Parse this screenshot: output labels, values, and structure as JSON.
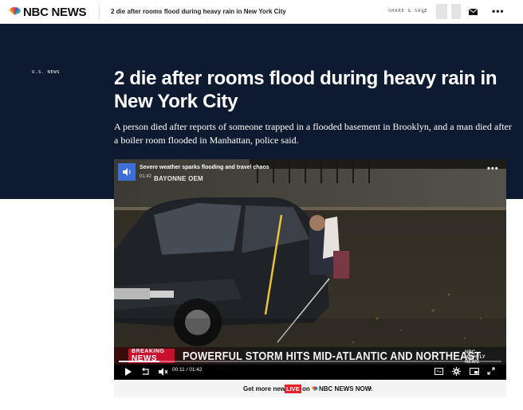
{
  "topbar": {
    "brand": "NBC NEWS",
    "article_title": "2 die after rooms flood during heavy rain in New York City",
    "share_label": "SHARE & SAVE",
    "menu_label": "•••"
  },
  "article": {
    "section": "U.S. NEWS",
    "headline": "2 die after rooms flood during heavy rain in New York City",
    "dek": "A person died after reports of someone trapped in a flooded basement in Brooklyn, and a man died after a boiler room flooded in Manhattan, police said."
  },
  "video": {
    "overlay_title": "Severe weather sparks flooding and travel chaos",
    "duration_badge": "01:42",
    "location_caption": "BAYONNE OEM",
    "breaking_top": "BREAKING",
    "breaking_bottom": "NEWS",
    "lower_third": "POWERFUL STORM HITS MID-ATLANTIC AND NORTHEAST",
    "program_logo": "NBC NIGHTLY NEWS",
    "current_time": "00:11",
    "separator": "/",
    "total_time": "01:42",
    "progress_fraction": 0.107,
    "menu_label": "•••"
  },
  "more_news": {
    "prefix": "Get more news",
    "live_badge": "LIVE",
    "on": "on",
    "network": "NBC NEWS NOW.",
    "chevron": "›"
  },
  "colors": {
    "hero_bg": "#0e1a30",
    "live_red": "#e62129",
    "breaking_red": "#c8102e",
    "mute_blue": "#3d6fd8"
  }
}
